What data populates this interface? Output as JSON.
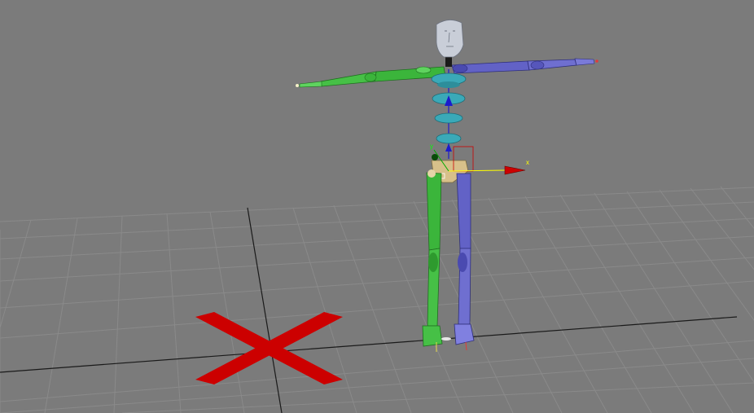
{
  "viewport": {
    "background": "#7b7b7b",
    "grid_color": "#8c8c8c",
    "grid_axis_color": "#111111"
  },
  "gizmo": {
    "x_label": "x",
    "y_label": "y",
    "x_color": "#ffff00",
    "y_color": "#00aa00",
    "z_color": "#cc0000"
  },
  "biped": {
    "left_side_color": "#3db83d",
    "right_side_color": "#6464c8",
    "spine_color": "#3aa9b8",
    "pelvis_color": "#d8c08a",
    "head_color": "#c9ced8"
  },
  "marker": {
    "icon": "x-marker",
    "color": "#cc0000"
  }
}
